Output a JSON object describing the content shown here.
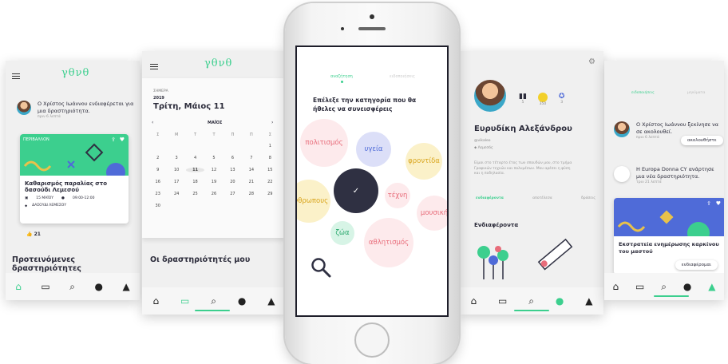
{
  "logo_text": "γθνθ",
  "colors": {
    "accent": "#3ccf8e",
    "dark": "#2f3042",
    "pink": "#e86c7a",
    "yellow": "#e9c24a"
  },
  "screen1": {
    "notif_text": "Ο Χρίστος Ιωάννου ενδιαφέρεται για μια δραστηριότητα.",
    "notif_time": "πριν 6 λεπτά",
    "card_tag": "ΠΕΡΙΒΑΛΛΟΝ",
    "card_title": "Καθαρισμός παραλίας στο δασούδι Λεμεσού",
    "card_date": "15 ΜΑΪΟΥ",
    "card_time": "09:00-12:00",
    "card_place": "ΔΑΣΟΥΔΙ ΛΕΜΕΣΟΥ",
    "likes": "21",
    "section_title": "Προτεινόμενες δραστηριότητες"
  },
  "screen2": {
    "today_label": "ΣΗΜΕΡΑ",
    "year": "2019",
    "date_title": "Τρίτη, Μάιος 11",
    "month": "ΜΑΪΟΣ",
    "weekdays": [
      "Σ",
      "Μ",
      "Τ",
      "Τ",
      "Π",
      "Π",
      "Σ"
    ],
    "days": [
      "",
      "",
      "",
      "",
      "",
      "",
      "1",
      "2",
      "3",
      "4",
      "5",
      "6",
      "7",
      "8",
      "9",
      "10",
      "11",
      "12",
      "13",
      "14",
      "15",
      "16",
      "17",
      "18",
      "19",
      "20",
      "21",
      "22",
      "23",
      "24",
      "25",
      "26",
      "27",
      "28",
      "29",
      "30",
      "",
      "",
      "",
      "",
      "",
      ""
    ],
    "section_title": "Οι δραστηριότητές μου"
  },
  "screen3": {
    "tab_search": "αναζήτηση",
    "tab_notifications": "ειδοποιήσεις",
    "prompt": "Επέλεξε την κατηγορία που θα ήθελες να συνεισφέρεις",
    "categories": {
      "culture": "πολιτισμός",
      "health": "υγεία",
      "care": "φροντίδα",
      "people": "άνθρωπους",
      "art": "τέχνη",
      "music": "μουσική",
      "animals": "ζώα",
      "sports": "αθλητισμός"
    }
  },
  "screen4": {
    "stats": [
      "5",
      "350",
      "3"
    ],
    "name": "Ευρυδίκη Αλεξάνδρου",
    "handle": "@vikaleo",
    "location": "Λεμεσός",
    "bio": "Είμαι στο τέταρτο έτος των σπουδών μου, στο τμήμα Γραφικών τεχνών και πολυμέσων. Μου αρέσει η φύση και η ποδηλασία.",
    "tabs": [
      "ενδιαφέροντα",
      "αποτέλεσα",
      "δράσεις"
    ],
    "section_title": "Ενδιαφέροντα"
  },
  "screen5": {
    "tab_left": "ειδοποιήσεις",
    "tab_right": "μηνύματα",
    "notif1_text": "Ο Χρίστος Ιωάννου ξεκίνησε να σε ακολουθεί.",
    "notif1_time": "πριν 6 λεπτά",
    "follow_button": "ακολουθήστε",
    "notif2_text": "Η Europa Donna CY ανάρτησε μια νέα δραστηριότητα.",
    "notif2_time": "τριν 21 λεπτά",
    "card_title": "Εκστρατεία ενημέρωσης καρκίνου του μαστού",
    "interest_button": "ενδιαφέρομαι"
  }
}
